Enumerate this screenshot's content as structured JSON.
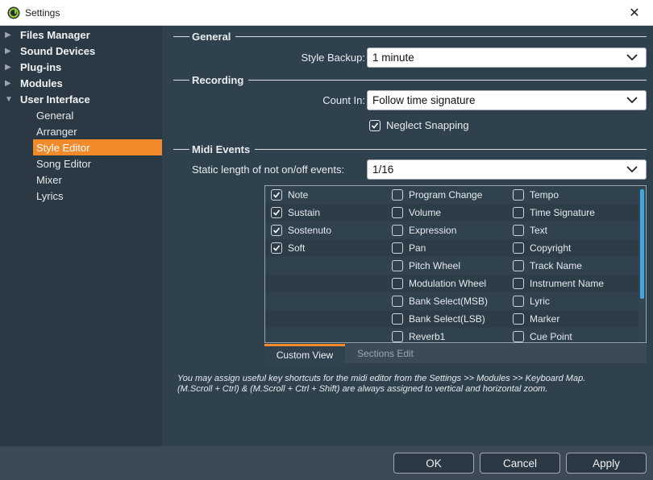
{
  "window": {
    "title": "Settings",
    "close_glyph": "✕",
    "app_icon": "app-logo-icon"
  },
  "sidebar": {
    "top_items": [
      {
        "label": "Files Manager",
        "expanded": false
      },
      {
        "label": "Sound Devices",
        "expanded": false
      },
      {
        "label": "Plug-ins",
        "expanded": false
      },
      {
        "label": "Modules",
        "expanded": false
      },
      {
        "label": "User Interface",
        "expanded": true
      }
    ],
    "children": [
      "General",
      "Arranger",
      "Style Editor",
      "Song Editor",
      "Mixer",
      "Lyrics"
    ],
    "selected": "Style Editor"
  },
  "general": {
    "heading": "General",
    "style_backup_label": "Style Backup:",
    "style_backup_value": "1 minute"
  },
  "recording": {
    "heading": "Recording",
    "count_in_label": "Count In:",
    "count_in_value": "Follow time signature",
    "neglect_label": "Neglect Snapping",
    "neglect_checked": true
  },
  "midi": {
    "heading": "Midi Events",
    "static_label": "Static length of not on/off events:",
    "static_value": "1/16",
    "columns": [
      [
        {
          "label": "Note",
          "checked": true
        },
        {
          "label": "Sustain",
          "checked": true
        },
        {
          "label": "Sostenuto",
          "checked": true
        },
        {
          "label": "Soft",
          "checked": true
        }
      ],
      [
        {
          "label": "Program Change",
          "checked": false
        },
        {
          "label": "Volume",
          "checked": false
        },
        {
          "label": "Expression",
          "checked": false
        },
        {
          "label": "Pan",
          "checked": false
        },
        {
          "label": "Pitch Wheel",
          "checked": false
        },
        {
          "label": "Modulation Wheel",
          "checked": false
        },
        {
          "label": "Bank Select(MSB)",
          "checked": false
        },
        {
          "label": "Bank Select(LSB)",
          "checked": false
        },
        {
          "label": "Reverb1",
          "checked": false
        }
      ],
      [
        {
          "label": "Tempo",
          "checked": false
        },
        {
          "label": "Time Signature",
          "checked": false
        },
        {
          "label": "Text",
          "checked": false
        },
        {
          "label": "Copyright",
          "checked": false
        },
        {
          "label": "Track Name",
          "checked": false
        },
        {
          "label": "Instrument Name",
          "checked": false
        },
        {
          "label": "Lyric",
          "checked": false
        },
        {
          "label": "Marker",
          "checked": false
        },
        {
          "label": "Cue Point",
          "checked": false
        }
      ]
    ],
    "tabs": [
      {
        "label": "Custom View",
        "active": true
      },
      {
        "label": "Sections Edit",
        "active": false
      }
    ],
    "note_line1": "You may assign useful key shortcuts for the midi editor from the Settings >> Modules >> Keyboard Map.",
    "note_line2": "(M.Scroll + Ctrl) & (M.Scroll + Ctrl + Shift) are always assigned to vertical and horizontal zoom."
  },
  "buttons": {
    "ok": "OK",
    "cancel": "Cancel",
    "apply": "Apply"
  },
  "colors": {
    "accent": "#f18a2b",
    "scrollbar": "#3ea6e0",
    "background": "#2f414d"
  }
}
